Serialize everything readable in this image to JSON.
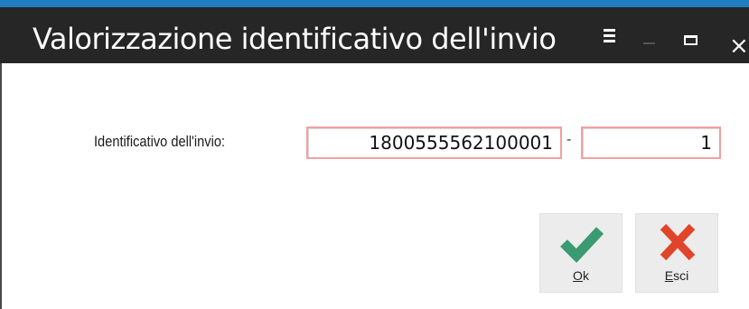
{
  "window": {
    "title": "Valorizzazione identificativo dell'invio",
    "controls": {
      "menu": "menu-icon",
      "minimize": "minimize-icon",
      "maximize": "maximize-icon",
      "close": "×"
    },
    "accent_color": "#1f7fc0",
    "titlebar_color": "#262626"
  },
  "form": {
    "label": "Identificativo dell'invio:",
    "identifier_value": "1800555562100001",
    "separator": "-",
    "progressive_value": "1",
    "field_border_color": "#f1a0a0"
  },
  "buttons": {
    "ok": {
      "mnemonic": "O",
      "rest": "k",
      "icon": "checkmark-icon",
      "icon_color": "#3a9a72"
    },
    "exit": {
      "mnemonic": "E",
      "rest": "sci",
      "icon": "x-icon",
      "icon_color": "#e0452b"
    }
  }
}
